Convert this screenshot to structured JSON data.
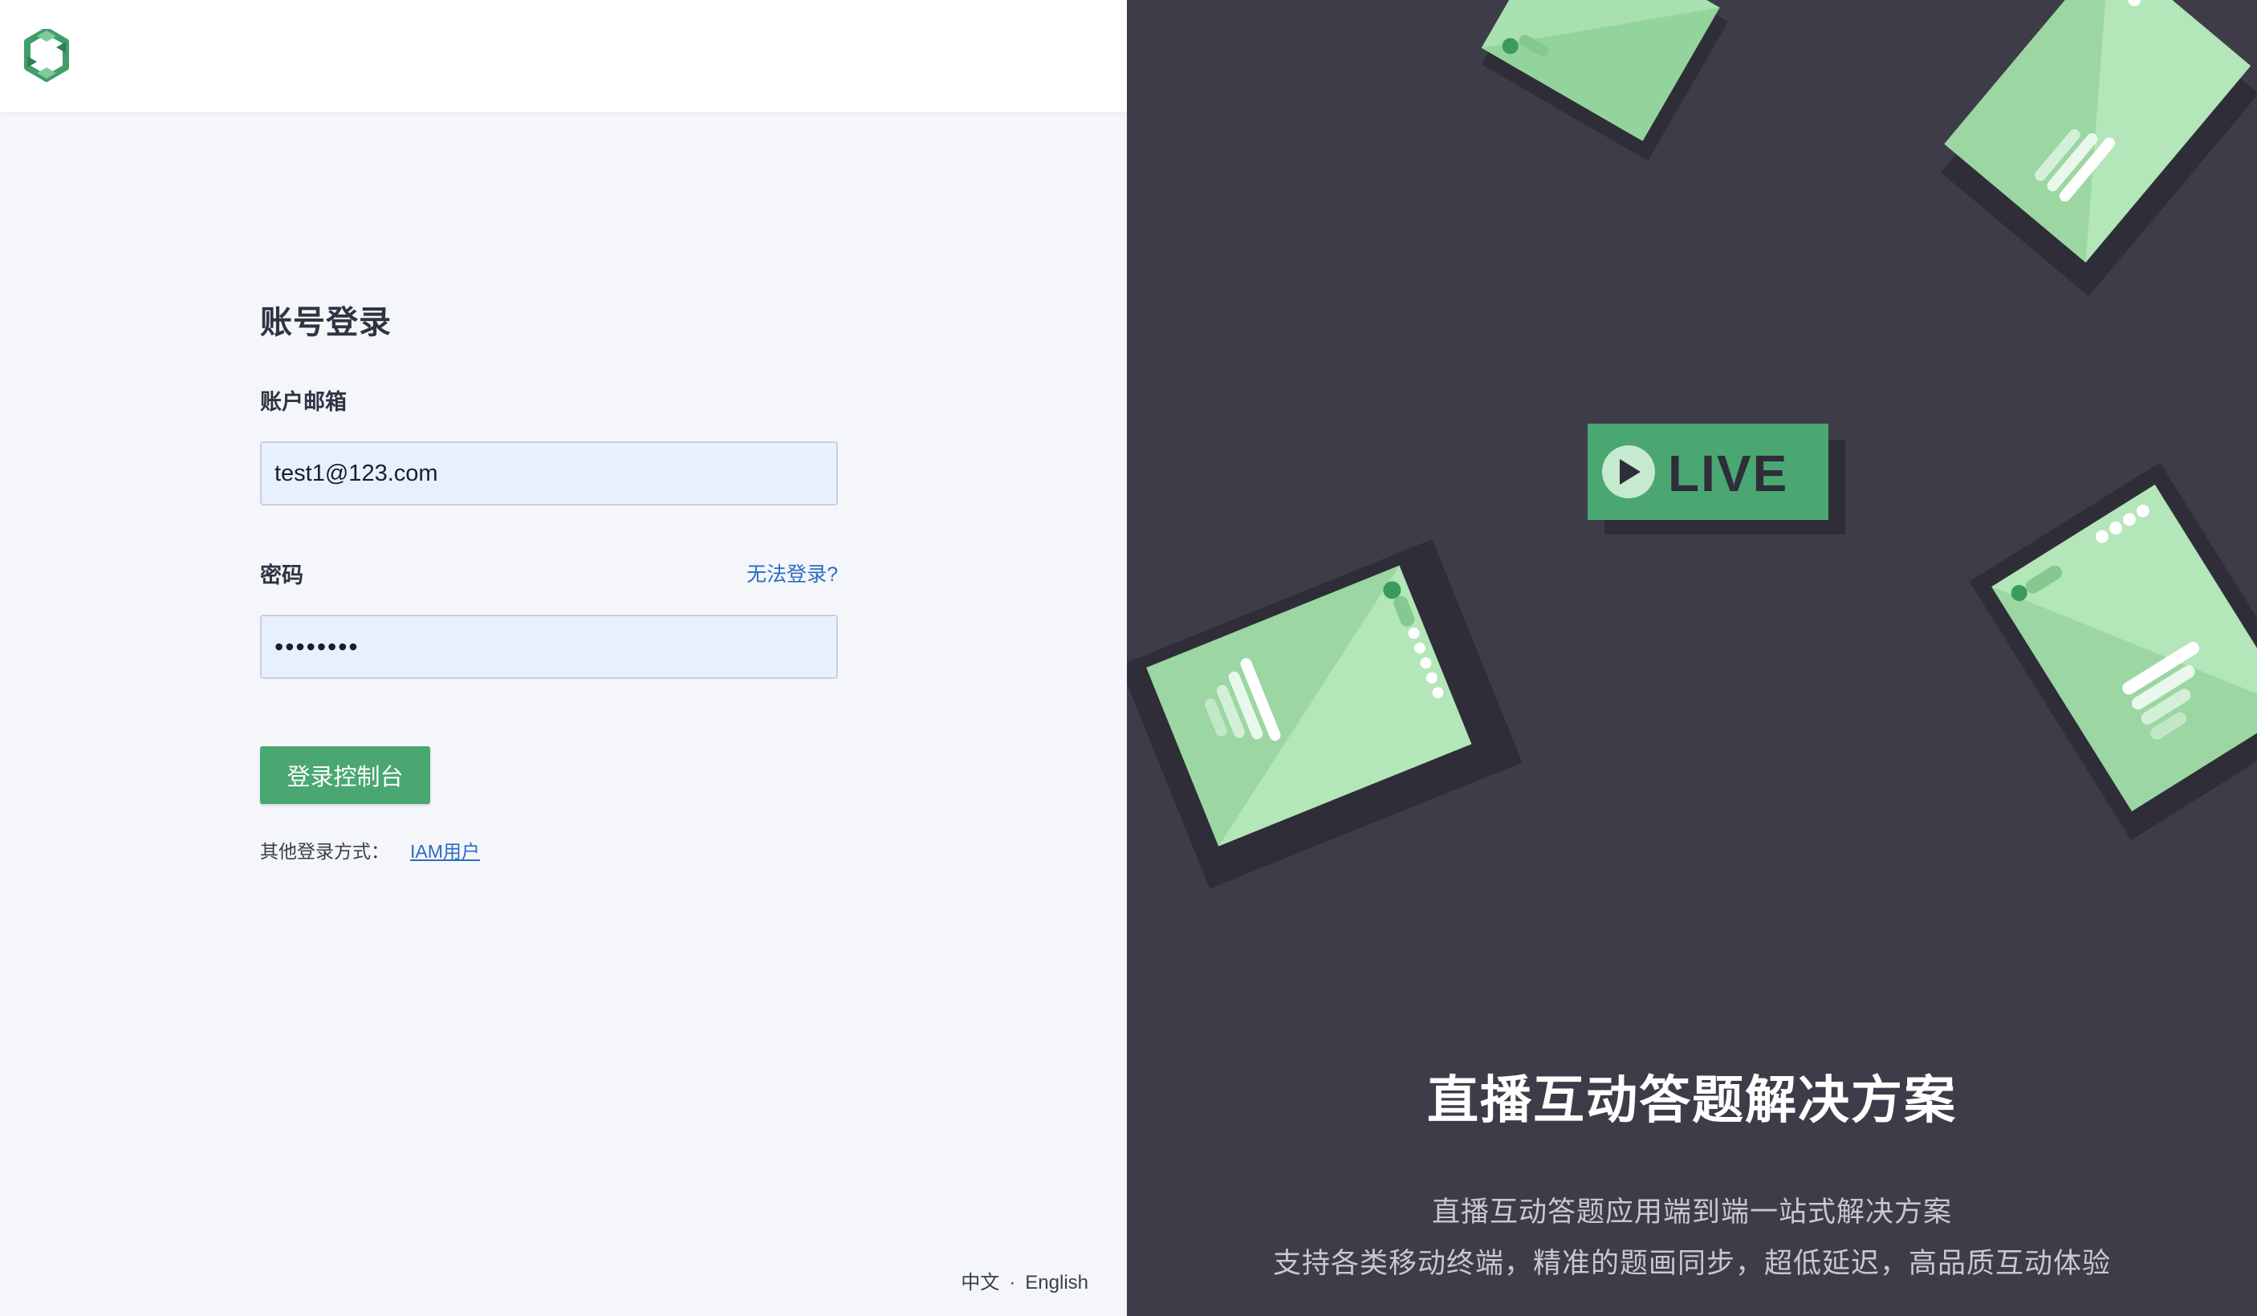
{
  "login": {
    "title": "账号登录",
    "email_label": "账户邮箱",
    "email_value": "test1@123.com",
    "password_label": "密码",
    "password_value": "••••••••",
    "forgot_link": "无法登录?",
    "submit_button": "登录控制台",
    "other_methods_label": "其他登录方式：",
    "iam_link": "IAM用户"
  },
  "language": {
    "chinese": "中文",
    "separator": "·",
    "english": "English"
  },
  "hero": {
    "badge_text": "LIVE",
    "title": "直播互动答题解决方案",
    "desc_line1": "直播互动答题应用端到端一站式解决方案",
    "desc_line2": "支持各类移动终端，精准的题画同步，超低延迟，高品质互动体验"
  },
  "colors": {
    "brand_green": "#4aa772",
    "link_blue": "#2d6bc4",
    "dark_panel": "#3e3c48",
    "input_bg": "#e8f0fe"
  }
}
